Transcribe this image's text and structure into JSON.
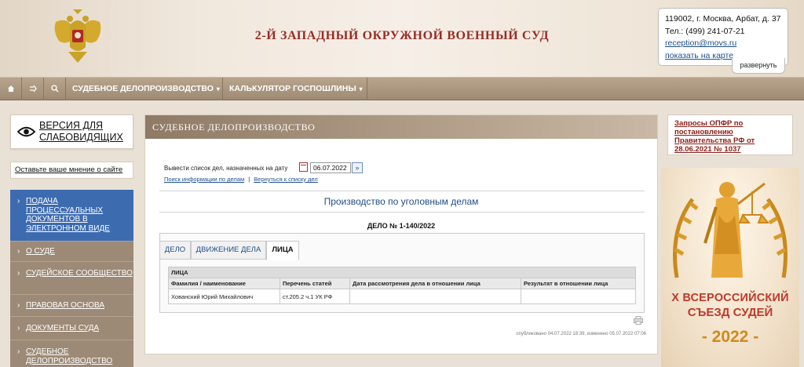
{
  "header": {
    "title": "2-Й ЗАПАДНЫЙ ОКРУЖНОЙ ВОЕННЫЙ СУД",
    "contact": {
      "address": "119002, г. Москва, Арбат, д. 37",
      "phone": "Тел.: (499) 241-07-21",
      "email": "reception@movs.ru",
      "map_link": "показать на карте",
      "expand": "развернуть"
    }
  },
  "nav": {
    "home_icon": "home-icon",
    "sitemap_icon": "sitemap-icon",
    "search_icon": "search-icon",
    "items": [
      {
        "label": "СУДЕБНОЕ ДЕЛОПРОИЗВОДСТВО"
      },
      {
        "label": "КАЛЬКУЛЯТОР ГОСПОШЛИНЫ"
      }
    ]
  },
  "sidebar": {
    "vision_label": "ВЕРСИЯ ДЛЯ СЛАБОВИДЯЩИХ",
    "feedback_label": "Оставьте ваше мнение о сайте",
    "menu": [
      {
        "label": "ПОДАЧА ПРОЦЕССУАЛЬНЫХ ДОКУМЕНТОВ В ЭЛЕКТРОННОМ ВИДЕ",
        "active": true
      },
      {
        "label": "О СУДЕ"
      },
      {
        "label": "СУДЕЙСКОЕ СООБЩЕСТВО"
      },
      {
        "label": "ПРАВОВАЯ ОСНОВА"
      },
      {
        "label": "ДОКУМЕНТЫ СУДА"
      },
      {
        "label": "СУДЕБНОЕ ДЕЛОПРОИЗВОДСТВО"
      }
    ]
  },
  "main": {
    "section_title": "СУДЕБНОЕ ДЕЛОПРОИЗВОДСТВО",
    "date_label": "Вывести список дел, назначенных на дату",
    "date_value": "06.07.2022",
    "search_link": "Поиск информации по делам",
    "separator": "|",
    "back_link": "Вернуться к списку дел",
    "production_title": "Производство по уголовным делам",
    "case_title": "ДЕЛО № 1-140/2022",
    "tabs": [
      {
        "label": "ДЕЛО"
      },
      {
        "label": "ДВИЖЕНИЕ ДЕЛА"
      },
      {
        "label": "ЛИЦА",
        "active": true
      }
    ],
    "persons": {
      "section_label": "ЛИЦА",
      "headers": [
        "Фамилия / наименование",
        "Перечень статей",
        "Дата рассмотрения дела в отношении лица",
        "Результат в отношении лица"
      ],
      "rows": [
        [
          "Хованский Юрий Михайлович",
          "ст.205.2 ч.1 УК РФ",
          "",
          ""
        ]
      ]
    },
    "published": "опубликовано 04.07.2022 18:39, изменено 05.07.2022 07:06"
  },
  "right": {
    "opfr_link": "Запросы ОПФР по постановлению Правительства РФ от 28.06.2021 № 1037",
    "banner": {
      "line1": "X ВСЕРОССИЙСКИЙ",
      "line2": "СЪЕЗД СУДЕЙ",
      "line3": "- 2022 -"
    }
  },
  "colors": {
    "title_red": "#9b2b24",
    "nav_brown": "#9f8a73",
    "menu_active_blue": "#3c6bb0",
    "link_blue": "#1f4d87",
    "banner_gold": "#d08a1a"
  }
}
